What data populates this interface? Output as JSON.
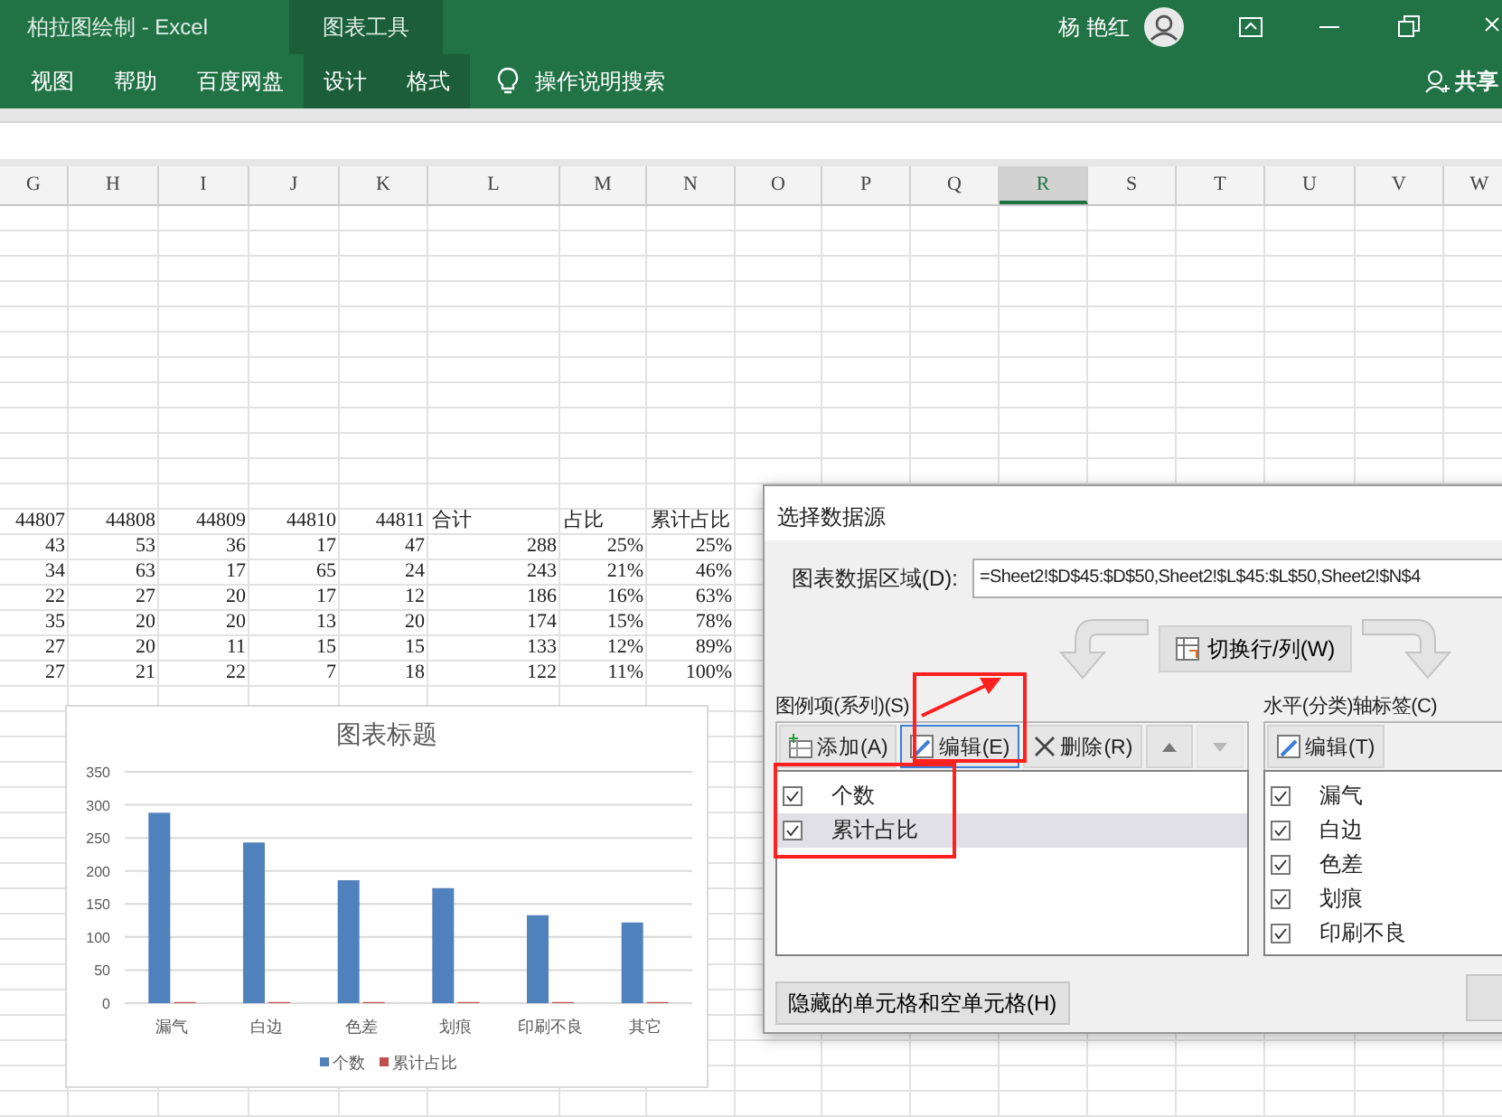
{
  "window": {
    "title": "柏拉图绘制  -  Excel",
    "context_title": "图表工具",
    "user": "杨 艳红"
  },
  "ribbon_tabs": [
    {
      "label": "视图",
      "contextual": false
    },
    {
      "label": "帮助",
      "contextual": false
    },
    {
      "label": "百度网盘",
      "contextual": false
    },
    {
      "label": "设计",
      "contextual": true
    },
    {
      "label": "格式",
      "contextual": true
    }
  ],
  "search": {
    "label": "操作说明搜索"
  },
  "share": {
    "label": "共享"
  },
  "sheet": {
    "columns": [
      {
        "label": "G",
        "selected": false
      },
      {
        "label": "H",
        "selected": false
      },
      {
        "label": "I",
        "selected": false
      },
      {
        "label": "J",
        "selected": false
      },
      {
        "label": "K",
        "selected": false
      },
      {
        "label": "L",
        "selected": false
      },
      {
        "label": "M",
        "selected": false
      },
      {
        "label": "N",
        "selected": false
      },
      {
        "label": "O",
        "selected": false
      },
      {
        "label": "P",
        "selected": false
      },
      {
        "label": "Q",
        "selected": false
      },
      {
        "label": "R",
        "selected": true
      },
      {
        "label": "S",
        "selected": false
      },
      {
        "label": "T",
        "selected": false
      },
      {
        "label": "U",
        "selected": false
      },
      {
        "label": "V",
        "selected": false
      },
      {
        "label": "W",
        "selected": false
      }
    ],
    "rows": [
      {
        "cells": [
          "44807",
          "44808",
          "44809",
          "44810",
          "44811",
          "合计",
          "占比",
          "累计占比"
        ]
      },
      {
        "cells": [
          "43",
          "53",
          "36",
          "17",
          "47",
          "288",
          "25%",
          "25%"
        ]
      },
      {
        "cells": [
          "34",
          "63",
          "17",
          "65",
          "24",
          "243",
          "21%",
          "46%"
        ]
      },
      {
        "cells": [
          "22",
          "27",
          "20",
          "17",
          "12",
          "186",
          "16%",
          "63%"
        ]
      },
      {
        "cells": [
          "35",
          "20",
          "20",
          "13",
          "20",
          "174",
          "15%",
          "78%"
        ]
      },
      {
        "cells": [
          "27",
          "20",
          "11",
          "15",
          "15",
          "133",
          "12%",
          "89%"
        ]
      },
      {
        "cells": [
          "27",
          "21",
          "22",
          "7",
          "18",
          "122",
          "11%",
          "100%"
        ]
      }
    ]
  },
  "chart": {
    "chart_data": {
      "type": "bar",
      "title": "图表标题",
      "grid": true,
      "legend": true,
      "categories": [
        "漏气",
        "白边",
        "色差",
        "划痕",
        "印刷不良",
        "其它"
      ],
      "ylim": [
        0,
        350
      ],
      "yticks": [
        0,
        50,
        100,
        150,
        200,
        250,
        300,
        350
      ],
      "series": [
        {
          "name": "个数",
          "color": "#4f81bd",
          "values": [
            288,
            243,
            186,
            174,
            133,
            122
          ]
        },
        {
          "name": "累计占比",
          "color": "#c0504d",
          "values": [
            0,
            0,
            0,
            0,
            0,
            0
          ]
        }
      ]
    }
  },
  "dialog": {
    "title": "选择数据源",
    "range_label": "图表数据区域(D):",
    "range_value": "=Sheet2!$D$45:$D$50,Sheet2!$L$45:$L$50,Sheet2!$N$4",
    "switch_button": "切换行/列(W)",
    "series_panel": {
      "label": "图例项(系列)(S)",
      "buttons": [
        {
          "kind": "add",
          "label": "添加(A)",
          "focused": false
        },
        {
          "kind": "edit",
          "label": "编辑(E)",
          "focused": true
        },
        {
          "kind": "delete",
          "label": "删除(R)",
          "focused": false
        },
        {
          "kind": "up",
          "disabled": false
        },
        {
          "kind": "down",
          "disabled": true
        }
      ],
      "items": [
        {
          "label": "个数",
          "checked": true,
          "selected": false
        },
        {
          "label": "累计占比",
          "checked": true,
          "selected": true
        }
      ]
    },
    "category_panel": {
      "label": "水平(分类)轴标签(C)",
      "buttons": [
        {
          "kind": "edit",
          "label": "编辑(T)",
          "focused": false
        }
      ],
      "items": [
        {
          "label": "漏气",
          "checked": true
        },
        {
          "label": "白边",
          "checked": true
        },
        {
          "label": "色差",
          "checked": true
        },
        {
          "label": "划痕",
          "checked": true
        },
        {
          "label": "印刷不良",
          "checked": true
        }
      ]
    },
    "hidden_cells_button": "隐藏的单元格和空单元格(H)"
  },
  "annotations": [
    {
      "kind": "box"
    },
    {
      "kind": "box"
    },
    {
      "kind": "arrow"
    }
  ]
}
